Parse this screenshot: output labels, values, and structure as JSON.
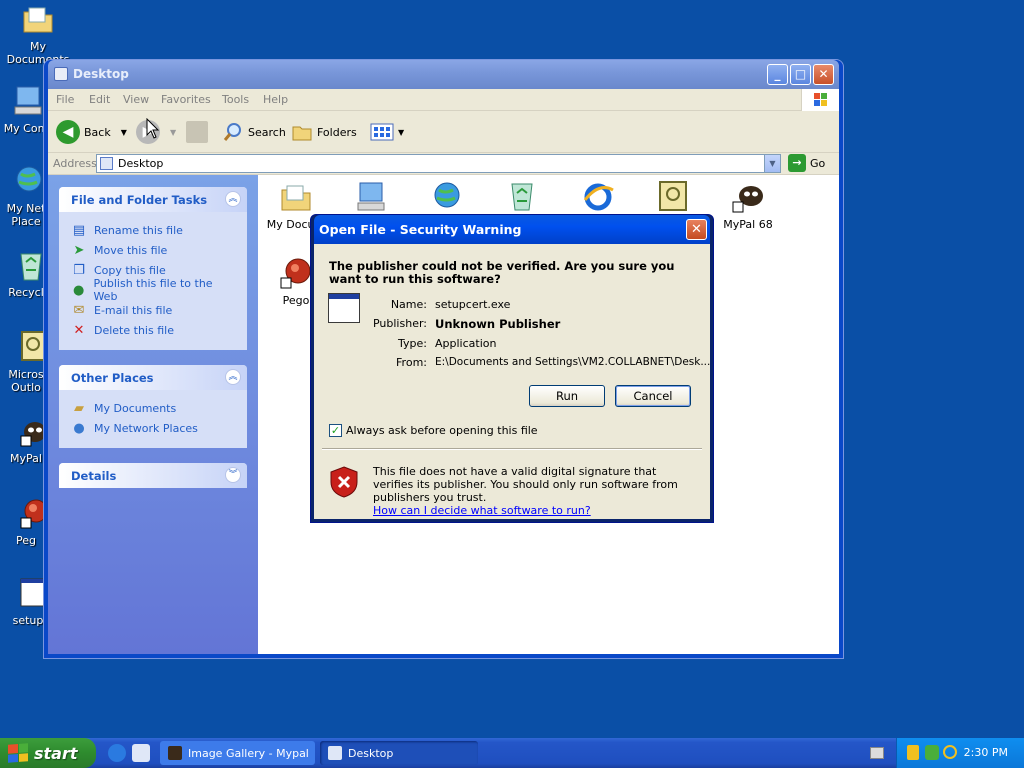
{
  "desktop": {
    "icons": [
      {
        "label": "My Documents"
      },
      {
        "label": "My Com"
      },
      {
        "label": "My Net"
      },
      {
        "label": "Place"
      },
      {
        "label": "Recycl"
      },
      {
        "label": "Micros"
      },
      {
        "label": "Outlo"
      },
      {
        "label": "MyPal"
      },
      {
        "label": "Peg"
      },
      {
        "label": "setup"
      }
    ]
  },
  "explorer": {
    "title": "Desktop",
    "menu": [
      "File",
      "Edit",
      "View",
      "Favorites",
      "Tools",
      "Help"
    ],
    "toolbar": {
      "back": "Back",
      "search": "Search",
      "folders": "Folders"
    },
    "address": {
      "label": "Address",
      "value": "Desktop",
      "go": "Go"
    },
    "tasks": {
      "file_folder": {
        "title": "File and Folder Tasks",
        "items": [
          "Rename this file",
          "Move this file",
          "Copy this file",
          "Publish this file to the Web",
          "E-mail this file",
          "Delete this file"
        ]
      },
      "other_places": {
        "title": "Other Places",
        "items": [
          "My Documents",
          "My Network Places"
        ]
      },
      "details": {
        "title": "Details"
      }
    },
    "files": [
      {
        "label": "My Docum"
      },
      {
        "label": ""
      },
      {
        "label": ""
      },
      {
        "label": ""
      },
      {
        "label": ""
      },
      {
        "label": ""
      },
      {
        "label": "MyPal 68"
      },
      {
        "label": "Pego"
      }
    ]
  },
  "dialog": {
    "title": "Open File - Security Warning",
    "question": "The publisher could not be verified.  Are you sure you want to run this software?",
    "fields": [
      {
        "key": "Name:",
        "value": "setupcert.exe"
      },
      {
        "key": "Publisher:",
        "value": "Unknown Publisher"
      },
      {
        "key": "Type:",
        "value": "Application"
      },
      {
        "key": "From:",
        "value": "E:\\Documents and Settings\\VM2.COLLABNET\\Desk..."
      }
    ],
    "run": "Run",
    "cancel": "Cancel",
    "checkbox": "Always ask before opening this file",
    "warning": "This file does not have a valid digital signature that verifies its publisher.  You should only run software from publishers you trust.",
    "link": "How can I decide what software to run?"
  },
  "taskbar": {
    "start": "start",
    "tasks": [
      "Image Gallery - Mypal",
      "Desktop"
    ],
    "clock": "2:30 PM"
  },
  "colors": {
    "desktop": "#0a4fa6",
    "task_link": "#215dc6",
    "start_green": "#3c9d3c"
  }
}
